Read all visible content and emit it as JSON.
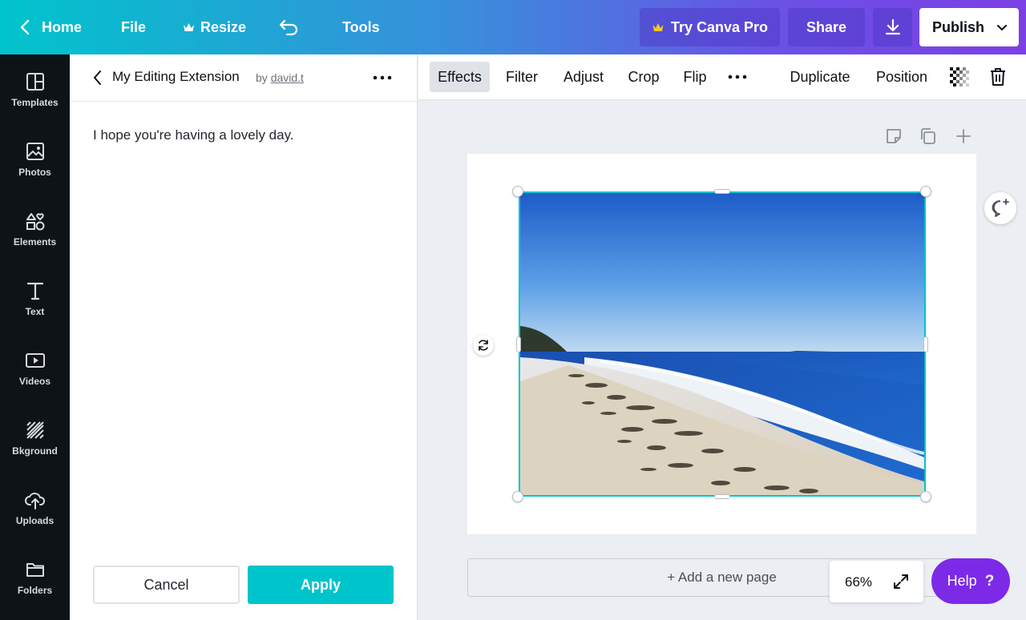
{
  "topbar": {
    "home": "Home",
    "file": "File",
    "resize": "Resize",
    "tools": "Tools",
    "try_pro": "Try Canva Pro",
    "share": "Share",
    "publish": "Publish"
  },
  "leftnav": {
    "items": [
      {
        "label": "Templates",
        "icon": "templates-icon"
      },
      {
        "label": "Photos",
        "icon": "photos-icon"
      },
      {
        "label": "Elements",
        "icon": "elements-icon"
      },
      {
        "label": "Text",
        "icon": "text-icon"
      },
      {
        "label": "Videos",
        "icon": "videos-icon"
      },
      {
        "label": "Bkground",
        "icon": "background-icon"
      },
      {
        "label": "Uploads",
        "icon": "uploads-icon"
      },
      {
        "label": "Folders",
        "icon": "folders-icon"
      }
    ]
  },
  "panel": {
    "title": "My Editing Extension",
    "by": "by",
    "author": "david.t",
    "message": "I hope you're having a lovely day.",
    "cancel": "Cancel",
    "apply": "Apply"
  },
  "toolbar": {
    "effects": "Effects",
    "filter": "Filter",
    "adjust": "Adjust",
    "crop": "Crop",
    "flip": "Flip",
    "duplicate": "Duplicate",
    "position": "Position"
  },
  "canvas": {
    "add_page": "+ Add a new page",
    "zoom": "66%",
    "help": "Help",
    "help_mark": "?"
  },
  "colors": {
    "accent": "#00c4cc",
    "help": "#7d2ae8",
    "nav_bg": "#0e1318"
  }
}
